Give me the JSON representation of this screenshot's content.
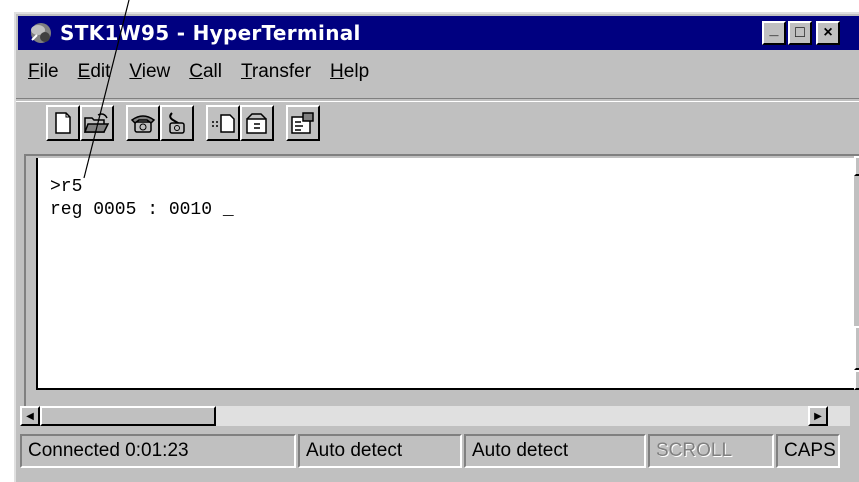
{
  "window": {
    "title": "STK1W95 - HyperTerminal",
    "controls": {
      "minimize": "_",
      "maximize": "□",
      "close": "×"
    }
  },
  "menu": [
    {
      "pre": "",
      "key": "F",
      "post": "ile"
    },
    {
      "pre": "",
      "key": "E",
      "post": "dit"
    },
    {
      "pre": "",
      "key": "V",
      "post": "iew"
    },
    {
      "pre": "",
      "key": "C",
      "post": "all"
    },
    {
      "pre": "",
      "key": "T",
      "post": "ransfer"
    },
    {
      "pre": "",
      "key": "H",
      "post": "elp"
    }
  ],
  "toolbar": {
    "icons": [
      "new-document-icon",
      "open-folder-icon",
      "phone-connect-icon",
      "phone-disconnect-icon",
      "send-file-icon",
      "receive-file-icon",
      "properties-icon"
    ]
  },
  "terminal": {
    "lines": [
      ">r5",
      "reg 0005 : 0010 _"
    ]
  },
  "status": {
    "connection": "Connected 0:01:23",
    "detect1": "Auto detect",
    "detect2": "Auto detect",
    "scroll": "SCROLL",
    "caps": "CAPS"
  },
  "colors": {
    "titlebar": "#000080",
    "face": "#c0c0c0"
  }
}
